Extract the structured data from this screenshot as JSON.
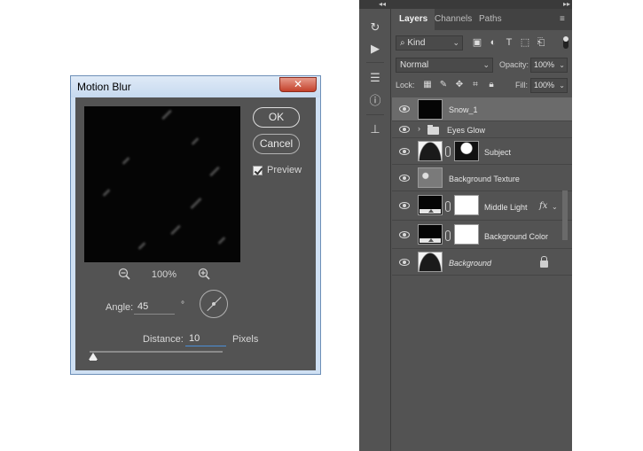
{
  "dialog": {
    "title": "Motion Blur",
    "close_label": "✕",
    "ok_label": "OK",
    "cancel_label": "Cancel",
    "preview_label": "Preview",
    "preview_checked": true,
    "zoom_level": "100%",
    "angle_label": "Angle:",
    "angle_value": "45",
    "angle_unit": "°",
    "distance_label": "Distance:",
    "distance_value": "10",
    "distance_unit": "Pixels"
  },
  "panel": {
    "tabs": [
      {
        "label": "Layers",
        "active": true
      },
      {
        "label": "Channels",
        "active": false
      },
      {
        "label": "Paths",
        "active": false
      }
    ],
    "filter_kind": "Kind",
    "blend_mode": "Normal",
    "opacity_label": "Opacity:",
    "opacity_value": "100%",
    "lock_label": "Lock:",
    "fill_label": "Fill:",
    "fill_value": "100%",
    "layers": [
      {
        "name": "Snow_1",
        "selected": true
      },
      {
        "name": "Eyes Glow",
        "type": "group"
      },
      {
        "name": "Subject"
      },
      {
        "name": "Background Texture"
      },
      {
        "name": "Middle Light",
        "fx": "fx"
      },
      {
        "name": "Background Color"
      },
      {
        "name": "Background",
        "locked": true
      }
    ]
  },
  "colors": {
    "panel_bg": "#535353",
    "selected_layer": "#6b6b6b",
    "dialog_frame": "#cfe0f3",
    "close_button": "#c4412b",
    "distance_underline": "#4b8ed6"
  }
}
